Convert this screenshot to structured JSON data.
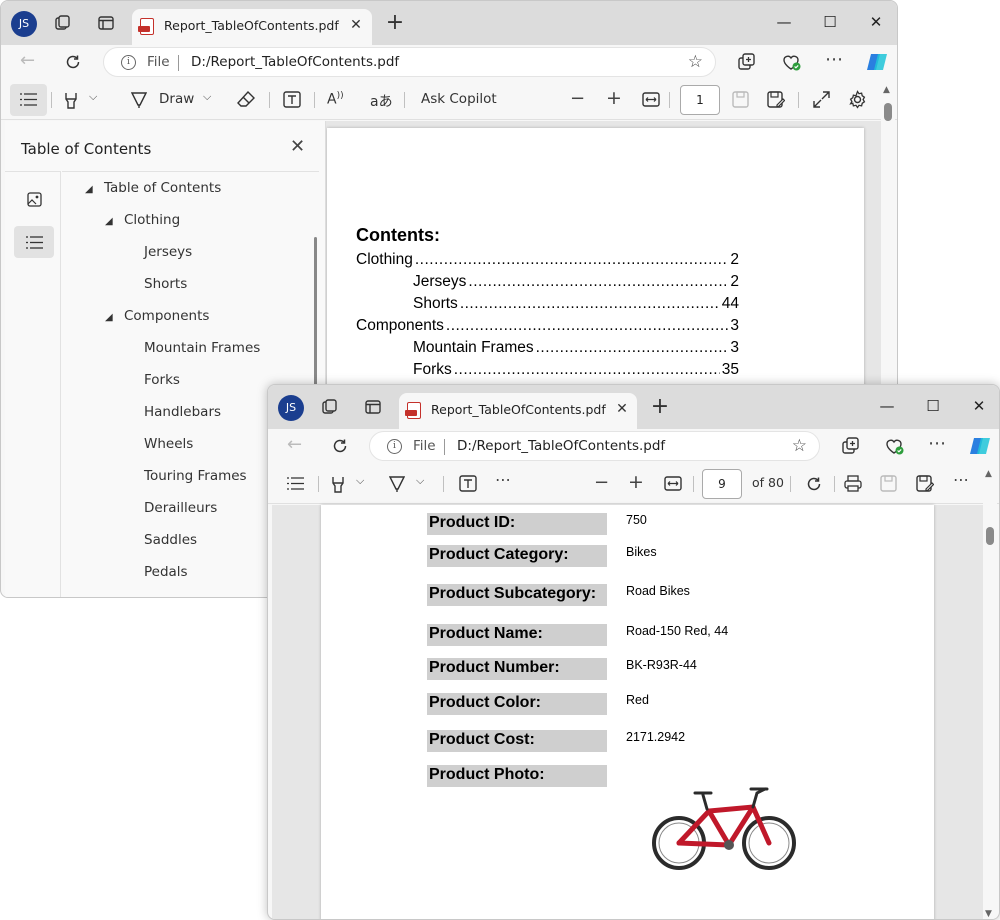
{
  "window1": {
    "avatar": "JS",
    "tab_title": "Report_TableOfContents.pdf",
    "address": {
      "protocol": "File",
      "url": "D:/Report_TableOfContents.pdf"
    },
    "toolbar": {
      "draw_label": "Draw",
      "copilot_label": "Ask Copilot",
      "page_number": "1"
    },
    "toc": {
      "heading": "Table of Contents",
      "root": "Table of Contents",
      "groups": [
        {
          "label": "Clothing",
          "children": [
            "Jerseys",
            "Shorts"
          ]
        },
        {
          "label": "Components",
          "children": [
            "Mountain Frames",
            "Forks",
            "Handlebars",
            "Wheels",
            "Touring Frames",
            "Derailleurs",
            "Saddles",
            "Pedals"
          ]
        }
      ]
    },
    "document": {
      "heading": "Contents:",
      "entries": [
        {
          "label": "Clothing",
          "page": "2"
        },
        {
          "label": "Jerseys",
          "page": "2"
        },
        {
          "label": "Shorts",
          "page": "44"
        },
        {
          "label": "Components",
          "page": "3"
        },
        {
          "label": "Mountain Frames",
          "page": "3"
        },
        {
          "label": "Forks",
          "page": "35"
        }
      ]
    }
  },
  "window2": {
    "avatar": "JS",
    "tab_title": "Report_TableOfContents.pdf",
    "address": {
      "protocol": "File",
      "url": "D:/Report_TableOfContents.pdf"
    },
    "toolbar": {
      "page_number": "9",
      "page_total": "of 80"
    },
    "product": {
      "fields": [
        {
          "label": "Product ID:",
          "value": "750"
        },
        {
          "label": "Product Category:",
          "value": "Bikes"
        },
        {
          "label": "Product Subcategory:",
          "value": "Road Bikes"
        },
        {
          "label": "Product Name:",
          "value": "Road-150 Red, 44"
        },
        {
          "label": "Product Number:",
          "value": "BK-R93R-44"
        },
        {
          "label": "Product Color:",
          "value": "Red"
        },
        {
          "label": "Product Cost:",
          "value": "2171.2942"
        },
        {
          "label": "Product Photo:",
          "value": ""
        }
      ],
      "photo": "red-bicycle-image"
    }
  },
  "colors": {
    "avatar": "#1b3e8f",
    "pdf_icon": "#c4312b",
    "label_bg": "#cfcfcf",
    "bike": "#c0182a"
  }
}
